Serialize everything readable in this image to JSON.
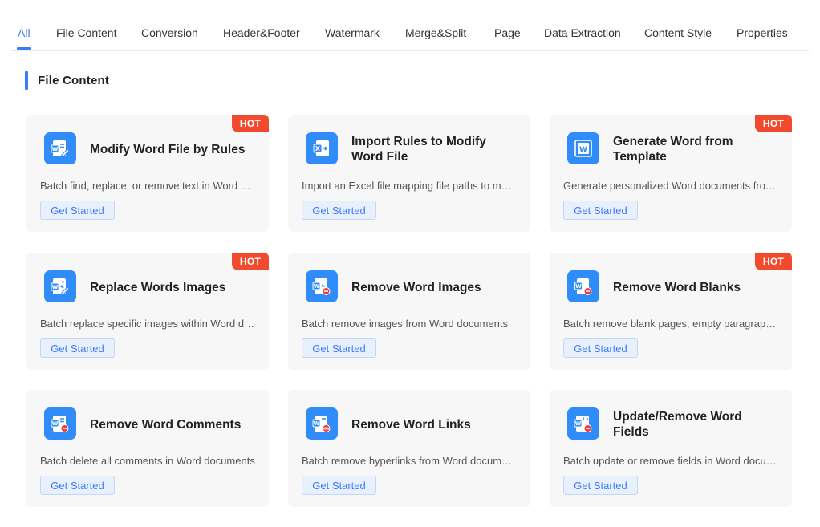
{
  "tabs": [
    {
      "label": "All",
      "active": true
    },
    {
      "label": "File Content"
    },
    {
      "label": "Conversion"
    },
    {
      "label": "Header&Footer"
    },
    {
      "label": "Watermark"
    },
    {
      "label": "Merge&Split"
    },
    {
      "label": "Page"
    },
    {
      "label": "Data Extraction"
    },
    {
      "label": "Content Style"
    },
    {
      "label": "Properties"
    }
  ],
  "section": {
    "title": "File Content"
  },
  "colors": {
    "accent": "#3a7bff",
    "icon_tile": "#2f8cf8",
    "hot_badge": "#f24a2e",
    "card_bg": "#f7f7f8",
    "remove_badge": "#f0393a"
  },
  "hot_label": "HOT",
  "cards": [
    {
      "title": "Modify Word File by Rules",
      "desc": "Batch find, replace, or remove text in Word documents",
      "button": "Get Started",
      "hot": true,
      "icon": "word-edit-icon"
    },
    {
      "title": "Import Rules to Modify Word File",
      "desc": "Import an Excel file mapping file paths to modification rules",
      "button": "Get Started",
      "hot": false,
      "icon": "excel-import-icon"
    },
    {
      "title": "Generate Word from Template",
      "desc": "Generate personalized Word documents from a template",
      "button": "Get Started",
      "hot": true,
      "icon": "word-template-icon"
    },
    {
      "title": "Replace Words Images",
      "desc": "Batch replace specific images within Word documents",
      "button": "Get Started",
      "hot": true,
      "icon": "word-image-edit-icon"
    },
    {
      "title": "Remove Word Images",
      "desc": "Batch remove images from Word documents",
      "button": "Get Started",
      "hot": false,
      "icon": "word-image-remove-icon"
    },
    {
      "title": "Remove Word Blanks",
      "desc": "Batch remove blank pages, empty paragraphs and spaces",
      "button": "Get Started",
      "hot": true,
      "icon": "word-blank-remove-icon"
    },
    {
      "title": "Remove Word Comments",
      "desc": "Batch delete all comments in Word documents",
      "button": "Get Started",
      "hot": false,
      "icon": "word-comment-remove-icon"
    },
    {
      "title": "Remove Word Links",
      "desc": "Batch remove hyperlinks from Word documents",
      "button": "Get Started",
      "hot": false,
      "icon": "word-link-remove-icon"
    },
    {
      "title": "Update/Remove Word Fields",
      "desc": "Batch update or remove fields in Word documents",
      "button": "Get Started",
      "hot": false,
      "icon": "word-field-icon"
    }
  ]
}
